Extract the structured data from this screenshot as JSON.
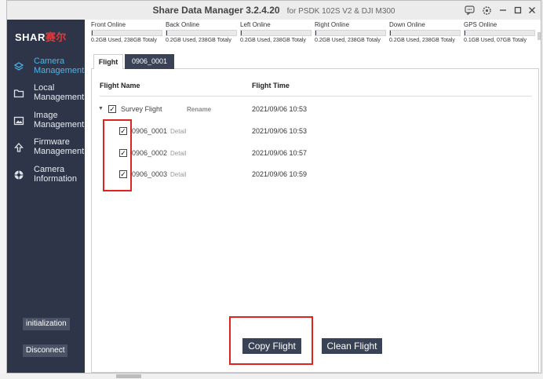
{
  "window": {
    "title": "Share Data Manager 3.2.4.20",
    "subtitle": "for PSDK 102S V2 & DJI M300",
    "icons": [
      "chat-icon",
      "settings-icon",
      "minimize-icon",
      "maximize-icon",
      "close-icon"
    ]
  },
  "logo": {
    "text": "SHAR",
    "cn": "赛尔"
  },
  "sidebar": {
    "items": [
      {
        "label1": "Camera",
        "label2": "Management",
        "icon": "layers-icon",
        "active": true
      },
      {
        "label1": "Local",
        "label2": "Management",
        "icon": "folder-icon",
        "active": false
      },
      {
        "label1": "Image",
        "label2": "Management",
        "icon": "image-icon",
        "active": false
      },
      {
        "label1": "Firmware",
        "label2": "Management",
        "icon": "upgrade-icon",
        "active": false
      },
      {
        "label1": "Camera",
        "label2": "Information",
        "icon": "camera-info-icon",
        "active": false
      }
    ],
    "initialization_label": "initialization",
    "disconnect_label": "Disconnect"
  },
  "drives": [
    {
      "name": "Front Online",
      "used": "0.2GB Used, 238GB Totaly",
      "usage_fraction": 0.001
    },
    {
      "name": "Back Online",
      "used": "0.2GB Used, 238GB Totaly",
      "usage_fraction": 0.001
    },
    {
      "name": "Left Online",
      "used": "0.2GB Used, 238GB Totaly",
      "usage_fraction": 0.001
    },
    {
      "name": "Right Online",
      "used": "0.2GB Used, 238GB Totaly",
      "usage_fraction": 0.001
    },
    {
      "name": "Down Online",
      "used": "0.2GB Used, 238GB Totaly",
      "usage_fraction": 0.001
    },
    {
      "name": "GPS Online",
      "used": "0.1GB Used, 07GB Totaly",
      "usage_fraction": 0.014
    }
  ],
  "tabs": [
    {
      "label": "Flight",
      "active": true
    },
    {
      "label": "0906_0001",
      "active": false
    }
  ],
  "table": {
    "col_name": "Flight Name",
    "col_time": "Flight Time",
    "group": {
      "name": "Survey Flight",
      "rename_label": "Rename",
      "time": "2021/09/06 10:53",
      "checked": true
    },
    "rows": [
      {
        "name": "0906_0001",
        "detail_label": "Detail",
        "time": "2021/09/06 10:53",
        "checked": true
      },
      {
        "name": "0906_0002",
        "detail_label": "Detail",
        "time": "2021/09/06 10:57",
        "checked": true
      },
      {
        "name": "0906_0003",
        "detail_label": "Detail",
        "time": "2021/09/06 10:59",
        "checked": true
      }
    ]
  },
  "actions": {
    "copy_label": "Copy Flight",
    "clean_label": "Clean Flight"
  },
  "colors": {
    "sidebar_bg": "#2e3548",
    "accent": "#4fb3e8",
    "button_bg": "#3a4256",
    "highlight": "#e0241d"
  }
}
